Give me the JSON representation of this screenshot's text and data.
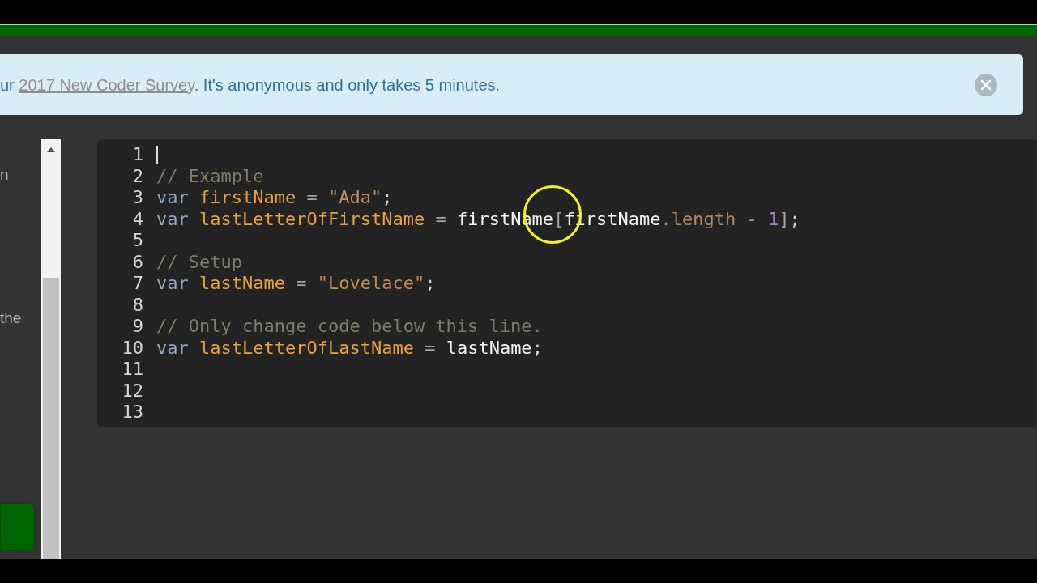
{
  "banner": {
    "text_before": "ur ",
    "link": "2017 New Coder Survey",
    "text_after": ". It's anonymous and only takes 5 minutes."
  },
  "left_panel": {
    "texts": [
      "n",
      "the"
    ]
  },
  "editor": {
    "lines": [
      {
        "number": "1",
        "caret": true
      },
      {
        "number": "2",
        "caret": false,
        "tokens": [
          {
            "text": "// Example",
            "kind": "comment"
          }
        ]
      },
      {
        "number": "3",
        "caret": false,
        "tokens": [
          {
            "text": "var",
            "kind": "keyword"
          },
          {
            "text": " firstName",
            "kind": "definition"
          },
          {
            "text": " = ",
            "kind": "operator"
          },
          {
            "text": "\"Ada\"",
            "kind": "string"
          },
          {
            "text": ";",
            "kind": "punctuation"
          }
        ]
      },
      {
        "number": "4",
        "caret": false,
        "tokens": [
          {
            "text": "var",
            "kind": "keyword"
          },
          {
            "text": " lastLetterOfFirstName",
            "kind": "definition"
          },
          {
            "text": " = ",
            "kind": "operator"
          },
          {
            "text": "firstName",
            "kind": "variable"
          },
          {
            "text": "[",
            "kind": "operator"
          },
          {
            "text": "firstName",
            "kind": "variable"
          },
          {
            "text": ".length",
            "kind": "property"
          },
          {
            "text": " - ",
            "kind": "operator"
          },
          {
            "text": "1",
            "kind": "number"
          },
          {
            "text": "]",
            "kind": "operator"
          },
          {
            "text": ";",
            "kind": "punctuation"
          }
        ]
      },
      {
        "number": "5",
        "caret": false
      },
      {
        "number": "6",
        "caret": false,
        "tokens": [
          {
            "text": "// Setup",
            "kind": "comment"
          }
        ]
      },
      {
        "number": "7",
        "caret": false,
        "tokens": [
          {
            "text": "var",
            "kind": "keyword"
          },
          {
            "text": " lastName",
            "kind": "definition"
          },
          {
            "text": " = ",
            "kind": "operator"
          },
          {
            "text": "\"Lovelace\"",
            "kind": "string"
          },
          {
            "text": ";",
            "kind": "punctuation"
          }
        ]
      },
      {
        "number": "8",
        "caret": false
      },
      {
        "number": "9",
        "caret": false,
        "tokens": [
          {
            "text": "// Only change code below this line.",
            "kind": "comment"
          }
        ]
      },
      {
        "number": "10",
        "caret": false,
        "tokens": [
          {
            "text": "var",
            "kind": "keyword"
          },
          {
            "text": " lastLetterOfLastName",
            "kind": "definition"
          },
          {
            "text": " = ",
            "kind": "operator"
          },
          {
            "text": "lastName",
            "kind": "variable"
          },
          {
            "text": ";",
            "kind": "punctuation"
          }
        ]
      },
      {
        "number": "11",
        "caret": false
      },
      {
        "number": "12",
        "caret": false
      },
      {
        "number": "13",
        "caret": false
      }
    ]
  }
}
